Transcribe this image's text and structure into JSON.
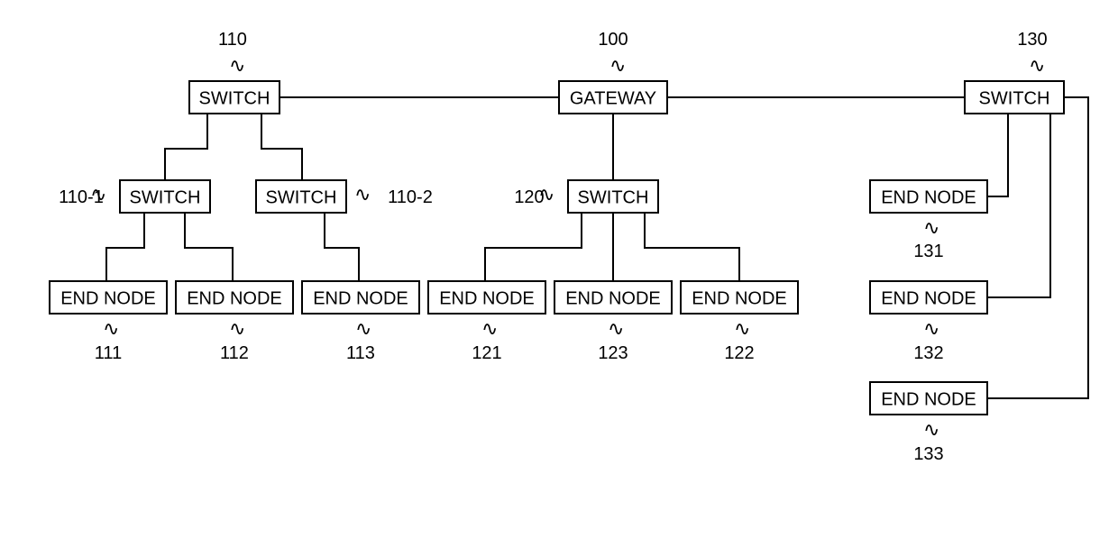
{
  "nodes": {
    "gateway": {
      "label": "GATEWAY",
      "ref": "100"
    },
    "sw110": {
      "label": "SWITCH",
      "ref": "110"
    },
    "sw110_1": {
      "label": "SWITCH",
      "ref": "110-1"
    },
    "sw110_2": {
      "label": "SWITCH",
      "ref": "110-2"
    },
    "sw120": {
      "label": "SWITCH",
      "ref": "120"
    },
    "sw130": {
      "label": "SWITCH",
      "ref": "130"
    },
    "en111": {
      "label": "END NODE",
      "ref": "111"
    },
    "en112": {
      "label": "END NODE",
      "ref": "112"
    },
    "en113": {
      "label": "END NODE",
      "ref": "113"
    },
    "en121": {
      "label": "END NODE",
      "ref": "121"
    },
    "en123": {
      "label": "END NODE",
      "ref": "123"
    },
    "en122": {
      "label": "END NODE",
      "ref": "122"
    },
    "en131": {
      "label": "END NODE",
      "ref": "131"
    },
    "en132": {
      "label": "END NODE",
      "ref": "132"
    },
    "en133": {
      "label": "END NODE",
      "ref": "133"
    }
  }
}
